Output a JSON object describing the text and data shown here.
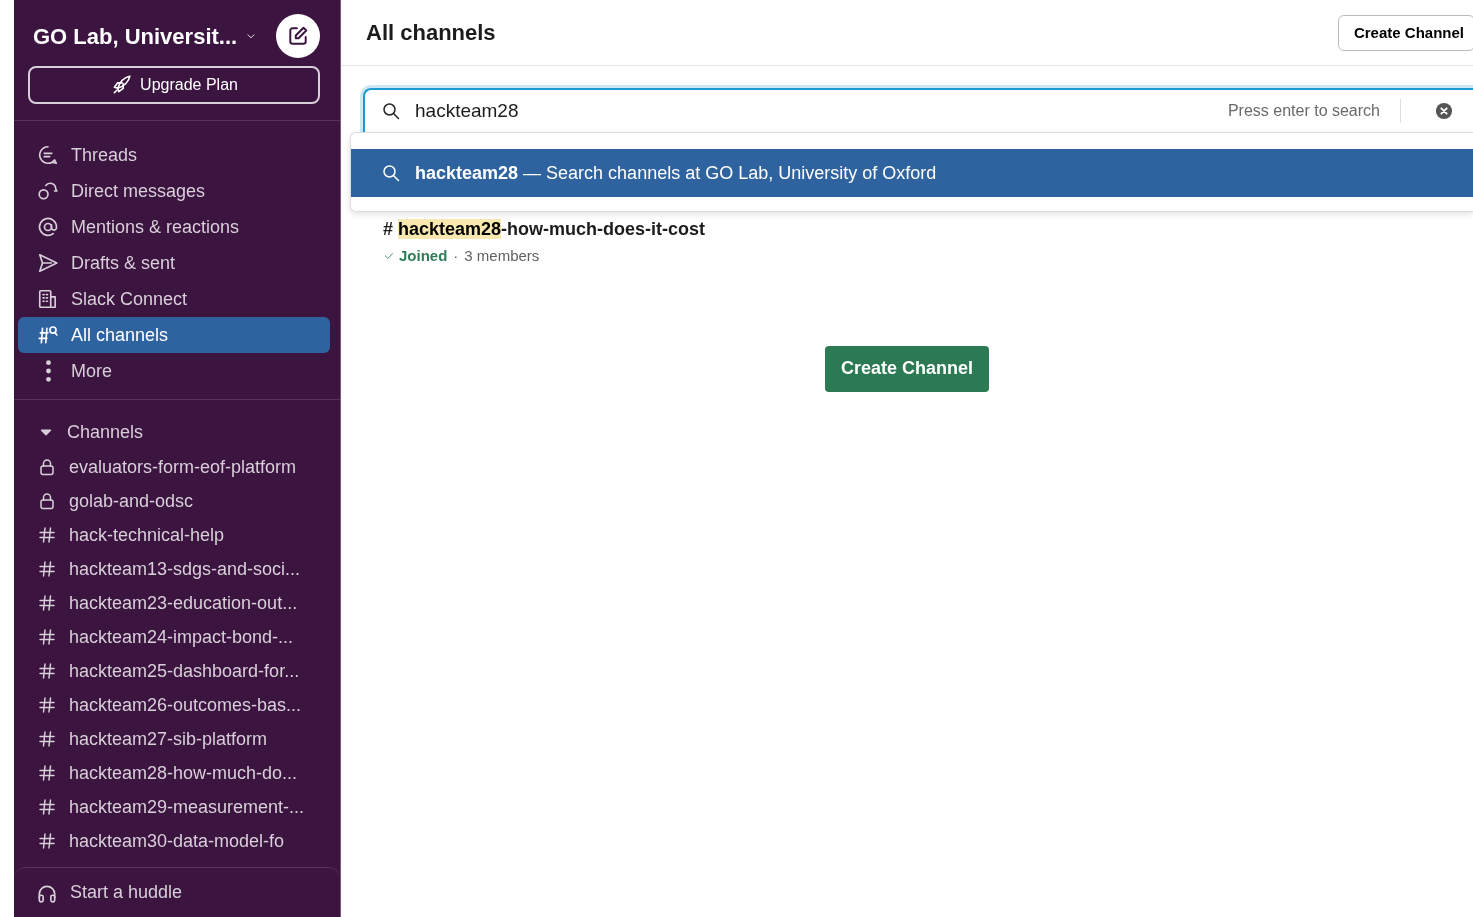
{
  "workspace": {
    "name": "GO Lab, Universit...",
    "upgrade_label": "Upgrade Plan"
  },
  "nav_items": [
    {
      "label": "Threads",
      "kind": "threads",
      "selected": false
    },
    {
      "label": "Direct messages",
      "kind": "dms",
      "selected": false
    },
    {
      "label": "Mentions & reactions",
      "kind": "mentions",
      "selected": false
    },
    {
      "label": "Drafts & sent",
      "kind": "drafts",
      "selected": false
    },
    {
      "label": "Slack Connect",
      "kind": "connect",
      "selected": false
    },
    {
      "label": "All channels",
      "kind": "channels",
      "selected": true
    },
    {
      "label": "More",
      "kind": "more",
      "selected": false
    }
  ],
  "channels_section": {
    "label": "Channels",
    "expanded": true,
    "items": [
      {
        "name": "evaluators-form-eof-platform",
        "kind": "private"
      },
      {
        "name": "golab-and-odsc",
        "kind": "private"
      },
      {
        "name": "hack-technical-help",
        "kind": "public"
      },
      {
        "name": "hackteam13-sdgs-and-soci...",
        "kind": "public"
      },
      {
        "name": "hackteam23-education-out...",
        "kind": "public"
      },
      {
        "name": "hackteam24-impact-bond-...",
        "kind": "public"
      },
      {
        "name": "hackteam25-dashboard-for...",
        "kind": "public"
      },
      {
        "name": "hackteam26-outcomes-bas...",
        "kind": "public"
      },
      {
        "name": "hackteam27-sib-platform",
        "kind": "public"
      },
      {
        "name": "hackteam28-how-much-do...",
        "kind": "public"
      },
      {
        "name": "hackteam29-measurement-...",
        "kind": "public"
      },
      {
        "name": "hackteam30-data-model-fo",
        "kind": "public"
      }
    ]
  },
  "huddle_label": "Start a huddle",
  "main": {
    "title": "All channels",
    "create_button": "Create Channel",
    "search": {
      "value": "hackteam28",
      "hint": "Press enter to search"
    },
    "suggestion": "**hackteam28** — Search channels at GO Lab, University of Oxford",
    "results": [
      {
        "prefix": "#",
        "name_match": "hackteam28",
        "name_rest": "-how-much-does-it-cost",
        "joined": true,
        "joined_label": "Joined",
        "separator": "·",
        "members": "3 members"
      }
    ],
    "center_button": "Create Channel"
  }
}
